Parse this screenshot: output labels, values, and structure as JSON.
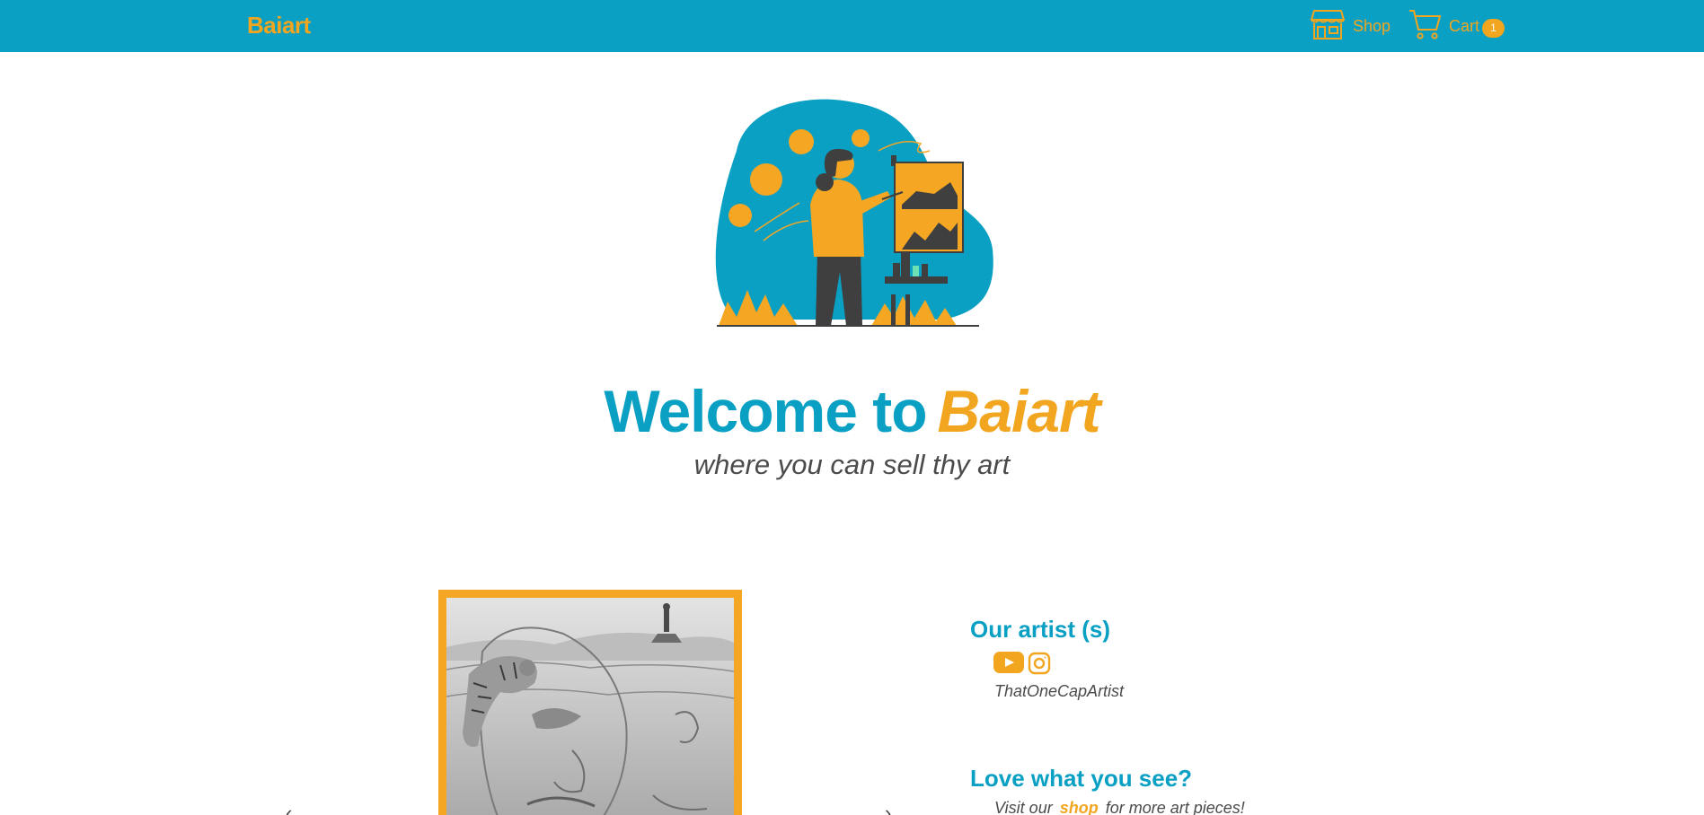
{
  "navbar": {
    "brand": "Baiart",
    "shop_label": "Shop",
    "cart_label": "Cart",
    "cart_count": "1"
  },
  "hero": {
    "welcome_prefix": "Welcome to",
    "welcome_brand": "Baiart",
    "tagline": "where you can sell thy art"
  },
  "carousel": {
    "prev_symbol": "‹",
    "next_symbol": "›"
  },
  "artists": {
    "heading": "Our artist (s)",
    "name": "ThatOneCapArtist",
    "social_icons": [
      "youtube-icon",
      "instagram-icon"
    ]
  },
  "promo": {
    "heading": "Love what you see?",
    "visit_prefix": "Visit our",
    "shop_link": "shop",
    "visit_suffix": "for more art pieces!"
  },
  "colors": {
    "primary_teal": "#0aa0c4",
    "accent_orange": "#f2a51f",
    "text_gray": "#4b4b4b"
  }
}
